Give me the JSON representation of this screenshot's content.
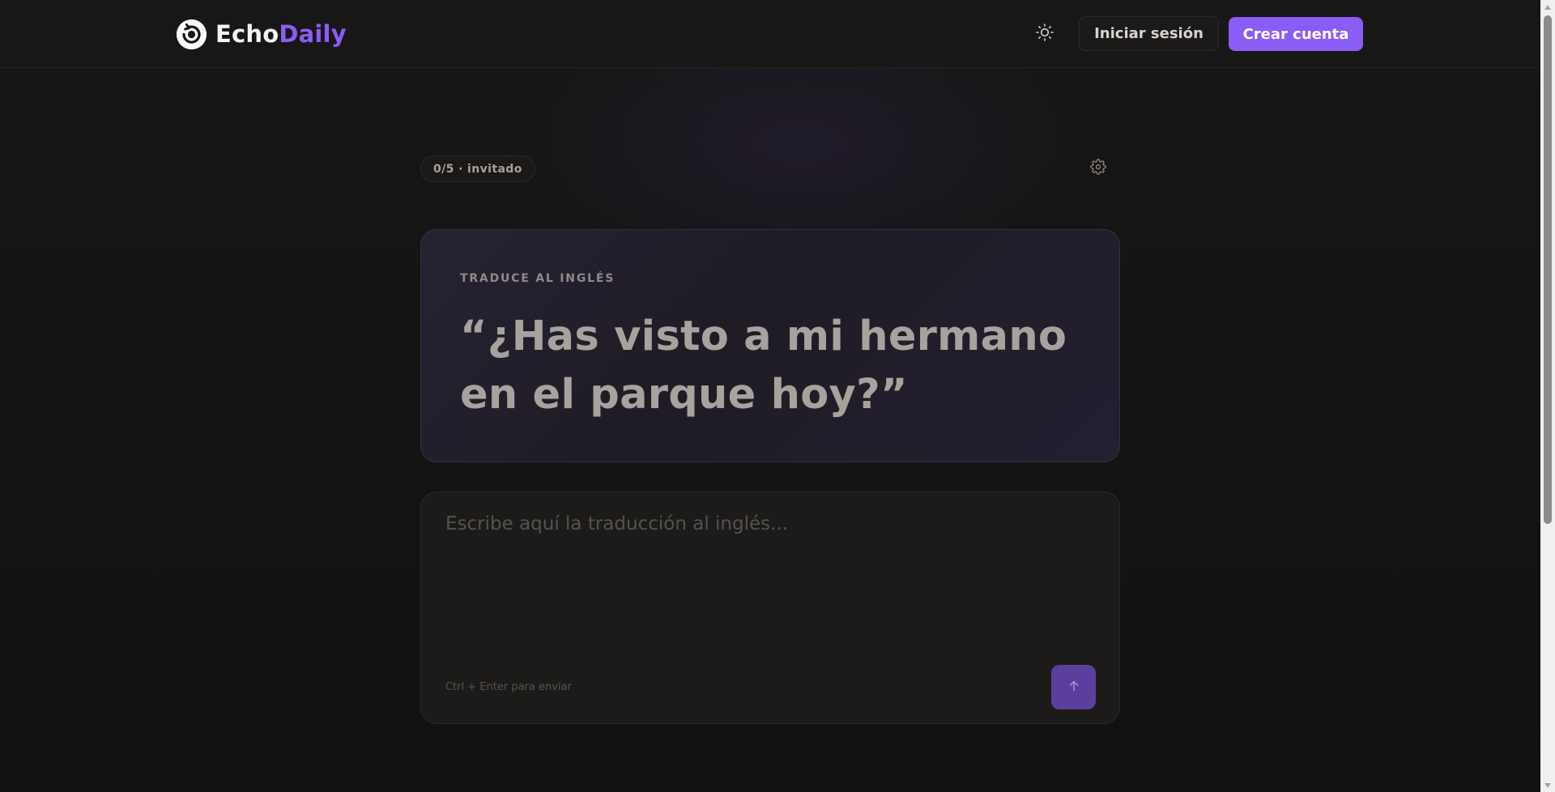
{
  "header": {
    "brand_part1": "Echo",
    "brand_part2": "Daily",
    "login_label": "Iniciar sesión",
    "signup_label": "Crear cuenta"
  },
  "session": {
    "counter": "0/5 · invitado"
  },
  "prompt": {
    "label": "TRADUCE AL INGLÉS",
    "text": "“¿Has visto a mi hermano en el parque hoy?”"
  },
  "answer": {
    "value": "",
    "placeholder": "Escribe aquí la traducción al inglés...",
    "hint": "Ctrl + Enter para enviar"
  },
  "icons": {
    "logo": "echo-logo-icon",
    "theme": "sun-icon",
    "settings": "gear-icon",
    "send": "arrow-up-icon"
  },
  "colors": {
    "accent": "#8b5cf6",
    "accent_dim": "#5b3f9e",
    "background": "#141312"
  }
}
